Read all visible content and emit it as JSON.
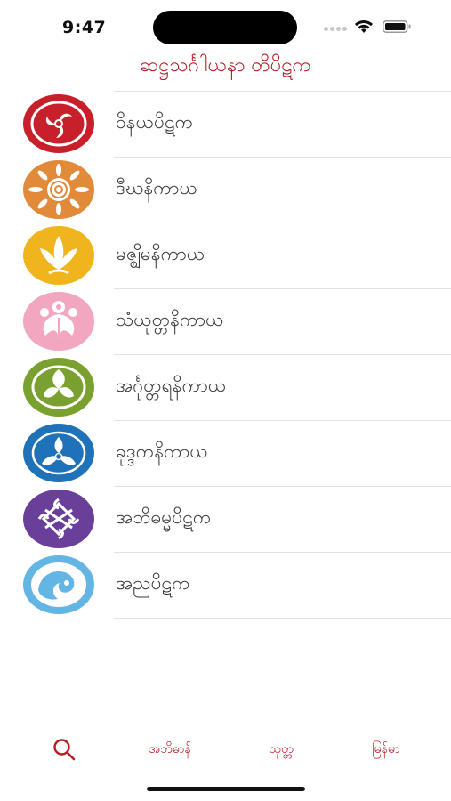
{
  "status_bar": {
    "time": "9:47"
  },
  "header": {
    "title": "ဆဋ္ဌသင်္ဂါယနာ တိပိဋက"
  },
  "list": {
    "items": [
      {
        "label": "ဝိနယပိဋက",
        "icon": "dharma-wheel-icon",
        "color": "#c8202a"
      },
      {
        "label": "ဒီဃနိကာယ",
        "icon": "sunflower-icon",
        "color": "#e18a3a"
      },
      {
        "label": "မဇ္ဈိမနိကာယ",
        "icon": "lotus-icon",
        "color": "#f0b51c"
      },
      {
        "label": "သံယုတ္တနိကာယ",
        "icon": "flower-crest-icon",
        "color": "#f3a6bf"
      },
      {
        "label": "အင်္ဂုတ္တရနိကာယ",
        "icon": "leaf-crest-icon",
        "color": "#7aa12f"
      },
      {
        "label": "ခုဒ္ဒကနိကာယ",
        "icon": "blossom-crest-icon",
        "color": "#1f72b8"
      },
      {
        "label": "အဘိဓမ္မပိဋက",
        "icon": "endless-knot-icon",
        "color": "#6a3f9a"
      },
      {
        "label": "အညပိဋက",
        "icon": "wave-icon",
        "color": "#63b5e3"
      }
    ]
  },
  "tabs": {
    "search_icon": "search-icon",
    "items": [
      {
        "label": "အဘိဓာန်"
      },
      {
        "label": "သုတ္တ"
      },
      {
        "label": "မြန်မာ"
      }
    ]
  },
  "colors": {
    "accent": "#b01f24",
    "separator": "#e2e2e2"
  }
}
